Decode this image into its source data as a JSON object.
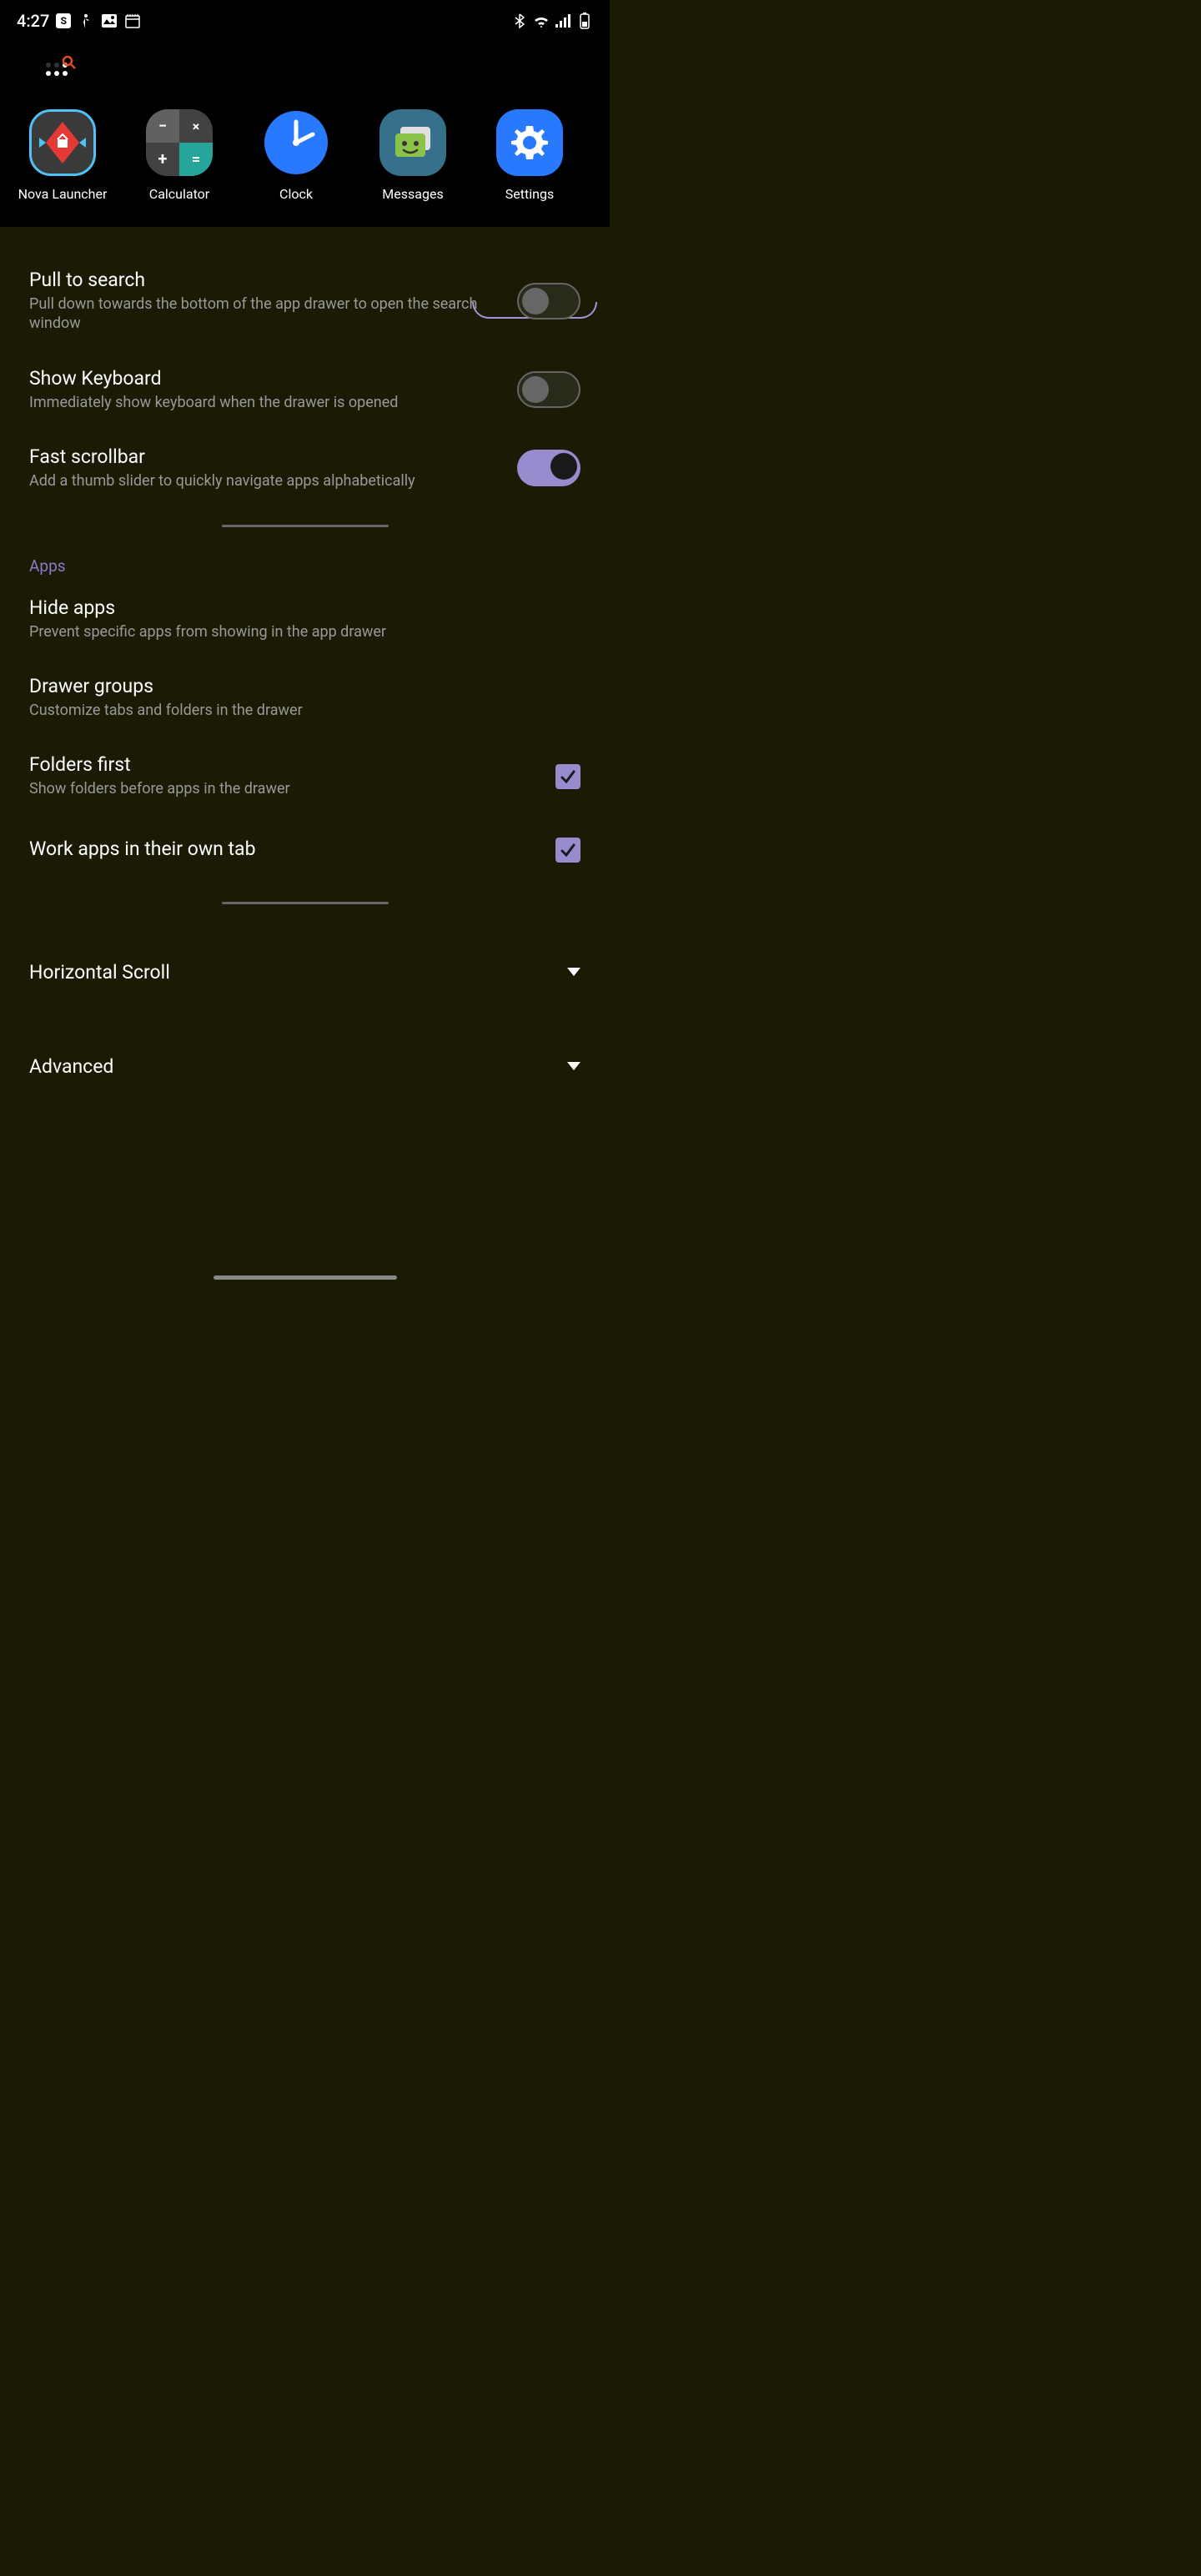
{
  "status": {
    "time": "4:27",
    "notif_icons": [
      "S",
      "walking",
      "image",
      "calendar"
    ],
    "system_icons": [
      "bluetooth",
      "wifi",
      "signal",
      "battery"
    ]
  },
  "tray": {
    "apps": [
      {
        "name": "Nova Launcher"
      },
      {
        "name": "Calculator"
      },
      {
        "name": "Clock"
      },
      {
        "name": "Messages"
      },
      {
        "name": "Settings"
      }
    ]
  },
  "settings": {
    "items1": [
      {
        "title": "Pull to search",
        "desc": "Pull down towards the bottom of the app drawer to open the search window",
        "toggle": false
      },
      {
        "title": "Show Keyboard",
        "desc": "Immediately show keyboard when the drawer is opened",
        "toggle": false
      },
      {
        "title": "Fast scrollbar",
        "desc": "Add a thumb slider to quickly navigate apps alphabetically",
        "toggle": true
      }
    ],
    "section2_header": "Apps",
    "items2": [
      {
        "title": "Hide apps",
        "desc": "Prevent specific apps from showing in the app drawer"
      },
      {
        "title": "Drawer groups",
        "desc": "Customize tabs and folders in the drawer"
      },
      {
        "title": "Folders first",
        "desc": "Show folders before apps in the drawer",
        "checked": true
      },
      {
        "title": "Work apps in their own tab",
        "checked": true
      }
    ],
    "expandables": [
      {
        "title": "Horizontal Scroll"
      },
      {
        "title": "Advanced"
      }
    ]
  }
}
